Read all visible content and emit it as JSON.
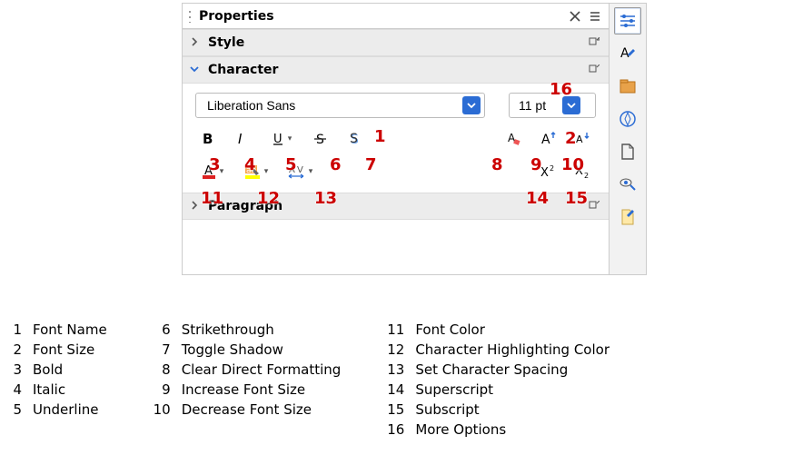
{
  "panel": {
    "title": "Properties",
    "sections": {
      "style": {
        "label": "Style",
        "expanded": false
      },
      "character": {
        "label": "Character",
        "expanded": true
      },
      "paragraph": {
        "label": "Paragraph",
        "expanded": false
      }
    }
  },
  "character": {
    "font_name": "Liberation Sans",
    "font_size": "11 pt"
  },
  "callouts": {
    "c1": "1",
    "c2": "2",
    "c3": "3",
    "c4": "4",
    "c5": "5",
    "c6": "6",
    "c7": "7",
    "c8": "8",
    "c9": "9",
    "c10": "10",
    "c11": "11",
    "c12": "12",
    "c13": "13",
    "c14": "14",
    "c15": "15",
    "c16": "16"
  },
  "legend": [
    {
      "n": "1",
      "t": "Font Name"
    },
    {
      "n": "2",
      "t": "Font Size"
    },
    {
      "n": "3",
      "t": "Bold"
    },
    {
      "n": "4",
      "t": "Italic"
    },
    {
      "n": "5",
      "t": "Underline"
    },
    {
      "n": "6",
      "t": "Strikethrough"
    },
    {
      "n": "7",
      "t": "Toggle Shadow"
    },
    {
      "n": "8",
      "t": "Clear Direct Formatting"
    },
    {
      "n": "9",
      "t": "Increase Font Size"
    },
    {
      "n": "10",
      "t": "Decrease Font Size"
    },
    {
      "n": "11",
      "t": "Font Color"
    },
    {
      "n": "12",
      "t": "Character Highlighting Color"
    },
    {
      "n": "13",
      "t": "Set Character Spacing"
    },
    {
      "n": "14",
      "t": "Superscript"
    },
    {
      "n": "15",
      "t": "Subscript"
    },
    {
      "n": "16",
      "t": "More Options"
    }
  ]
}
